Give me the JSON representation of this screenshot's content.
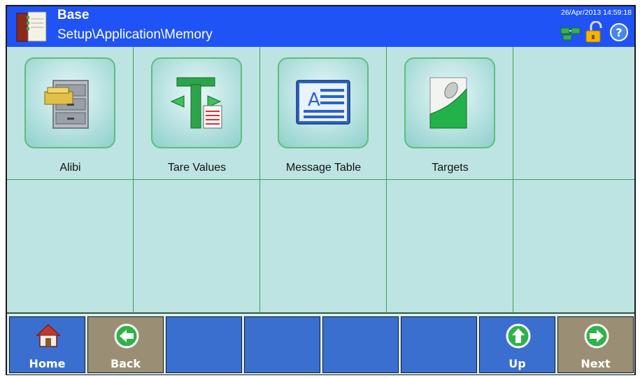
{
  "header": {
    "title": "Base",
    "breadcrumb": "Setup\\Application\\Memory",
    "datetime": "26/Apr/2013 14:59:18",
    "colors": {
      "bar": "#1f53f5",
      "text": "#ffffff"
    },
    "status_icons": [
      "network-icon",
      "padlock-unlocked-icon",
      "help-icon"
    ]
  },
  "grid": {
    "items": [
      {
        "label": "Alibi",
        "icon": "file-cabinet-icon"
      },
      {
        "label": "Tare Values",
        "icon": "tare-values-icon"
      },
      {
        "label": "Message Table",
        "icon": "message-table-icon"
      },
      {
        "label": "Targets",
        "icon": "targets-icon"
      }
    ],
    "colors": {
      "background": "#bde4e2",
      "lines": "#3f9d55"
    }
  },
  "softkeys": [
    {
      "label": "Home",
      "icon": "home-icon"
    },
    {
      "label": "Back",
      "icon": "arrow-left-icon"
    },
    {
      "label": "",
      "icon": ""
    },
    {
      "label": "",
      "icon": ""
    },
    {
      "label": "",
      "icon": ""
    },
    {
      "label": "",
      "icon": ""
    },
    {
      "label": "Up",
      "icon": "arrow-up-icon"
    },
    {
      "label": "Next",
      "icon": "arrow-right-icon"
    }
  ]
}
